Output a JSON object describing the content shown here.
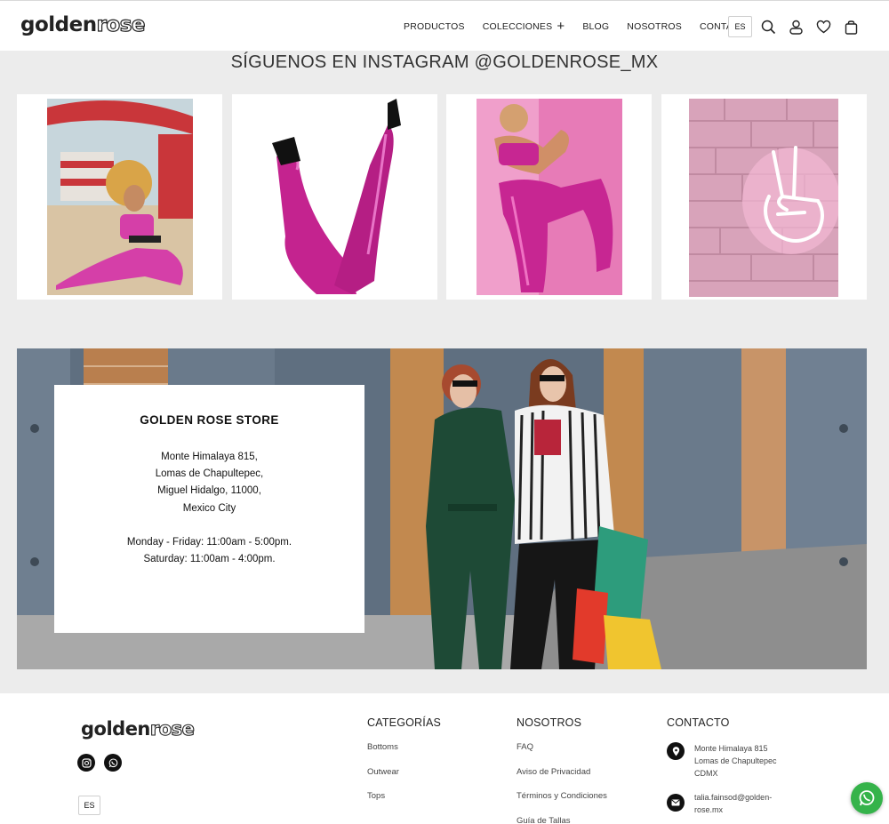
{
  "header": {
    "logo": {
      "part1": "golden",
      "part2": "rose"
    },
    "nav": [
      {
        "label": "PRODUCTOS"
      },
      {
        "label": "COLECCIONES",
        "has_plus": true
      },
      {
        "label": "BLOG"
      },
      {
        "label": "NOSOTROS"
      },
      {
        "label": "CONTACTO"
      }
    ],
    "lang": "ES",
    "icons": [
      "search-icon",
      "user-icon",
      "heart-icon",
      "bag-icon"
    ]
  },
  "instagram": {
    "title": "SÍGUENOS EN INSTAGRAM @GOLDENROSE_MX",
    "posts": [
      "ig-post-beach",
      "ig-post-legs",
      "ig-post-pink",
      "ig-post-neon-hand"
    ]
  },
  "store": {
    "title": "GOLDEN ROSE STORE",
    "address": [
      "Monte Himalaya 815,",
      "Lomas de Chapultepec,",
      "Miguel Hidalgo, 11000,",
      "Mexico City"
    ],
    "hours": [
      "Monday - Friday: 11:00am - 5:00pm.",
      "Saturday: 11:00am - 4:00pm."
    ]
  },
  "footer": {
    "logo": {
      "part1": "golden",
      "part2": "rose"
    },
    "lang": "ES",
    "categorias": {
      "title": "CATEGORÍAS",
      "links": [
        "Bottoms",
        "Outwear",
        "Tops"
      ]
    },
    "nosotros": {
      "title": "NOSOTROS",
      "links": [
        "FAQ",
        "Aviso de Privacidad",
        "Términos y Condiciones",
        "Guía de Tallas"
      ]
    },
    "contacto": {
      "title": "CONTACTO",
      "address": [
        "Monte Himalaya 815",
        "Lomas de Chapultepec",
        "CDMX"
      ],
      "email": [
        "talia.fainsod@golden-",
        "rose.mx"
      ]
    }
  },
  "colors": {
    "accent": "#d63aa8",
    "whatsapp": "#35b34a"
  }
}
